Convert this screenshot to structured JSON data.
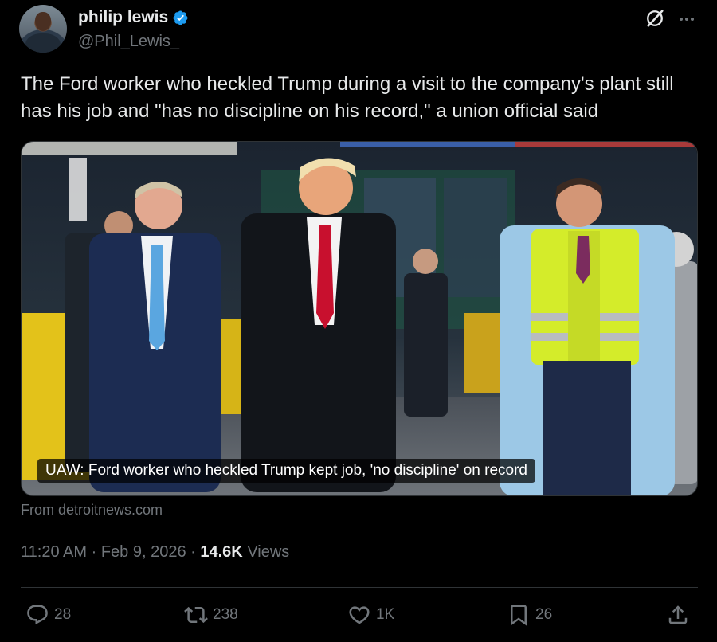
{
  "author": {
    "display_name": "philip lewis",
    "handle": "@Phil_Lewis_",
    "verified": true
  },
  "icons": {
    "verified": "verified-badge-icon",
    "grok": "grok-icon",
    "more": "more-options-icon",
    "reply": "reply-icon",
    "repost": "repost-icon",
    "like": "like-icon",
    "bookmark": "bookmark-icon",
    "share": "share-icon"
  },
  "colors": {
    "background": "#000000",
    "text": "#e7e9ea",
    "secondary_text": "#71767b",
    "verified_blue": "#1d9bf0",
    "divider": "#2f3336"
  },
  "tweet": {
    "text": "The Ford worker who heckled Trump during a visit to the company's plant still has his job and \"has no discipline on his record,\" a union official said"
  },
  "media": {
    "caption": "UAW: Ford worker who heckled Trump kept job, 'no discipline' on record",
    "source": "From detroitnews.com"
  },
  "meta": {
    "time": "11:20 AM",
    "date": "Feb 9, 2026",
    "separator": "·",
    "views_count": "14.6K",
    "views_label": "Views"
  },
  "actions": {
    "replies": "28",
    "reposts": "238",
    "likes": "1K",
    "bookmarks": "26"
  }
}
